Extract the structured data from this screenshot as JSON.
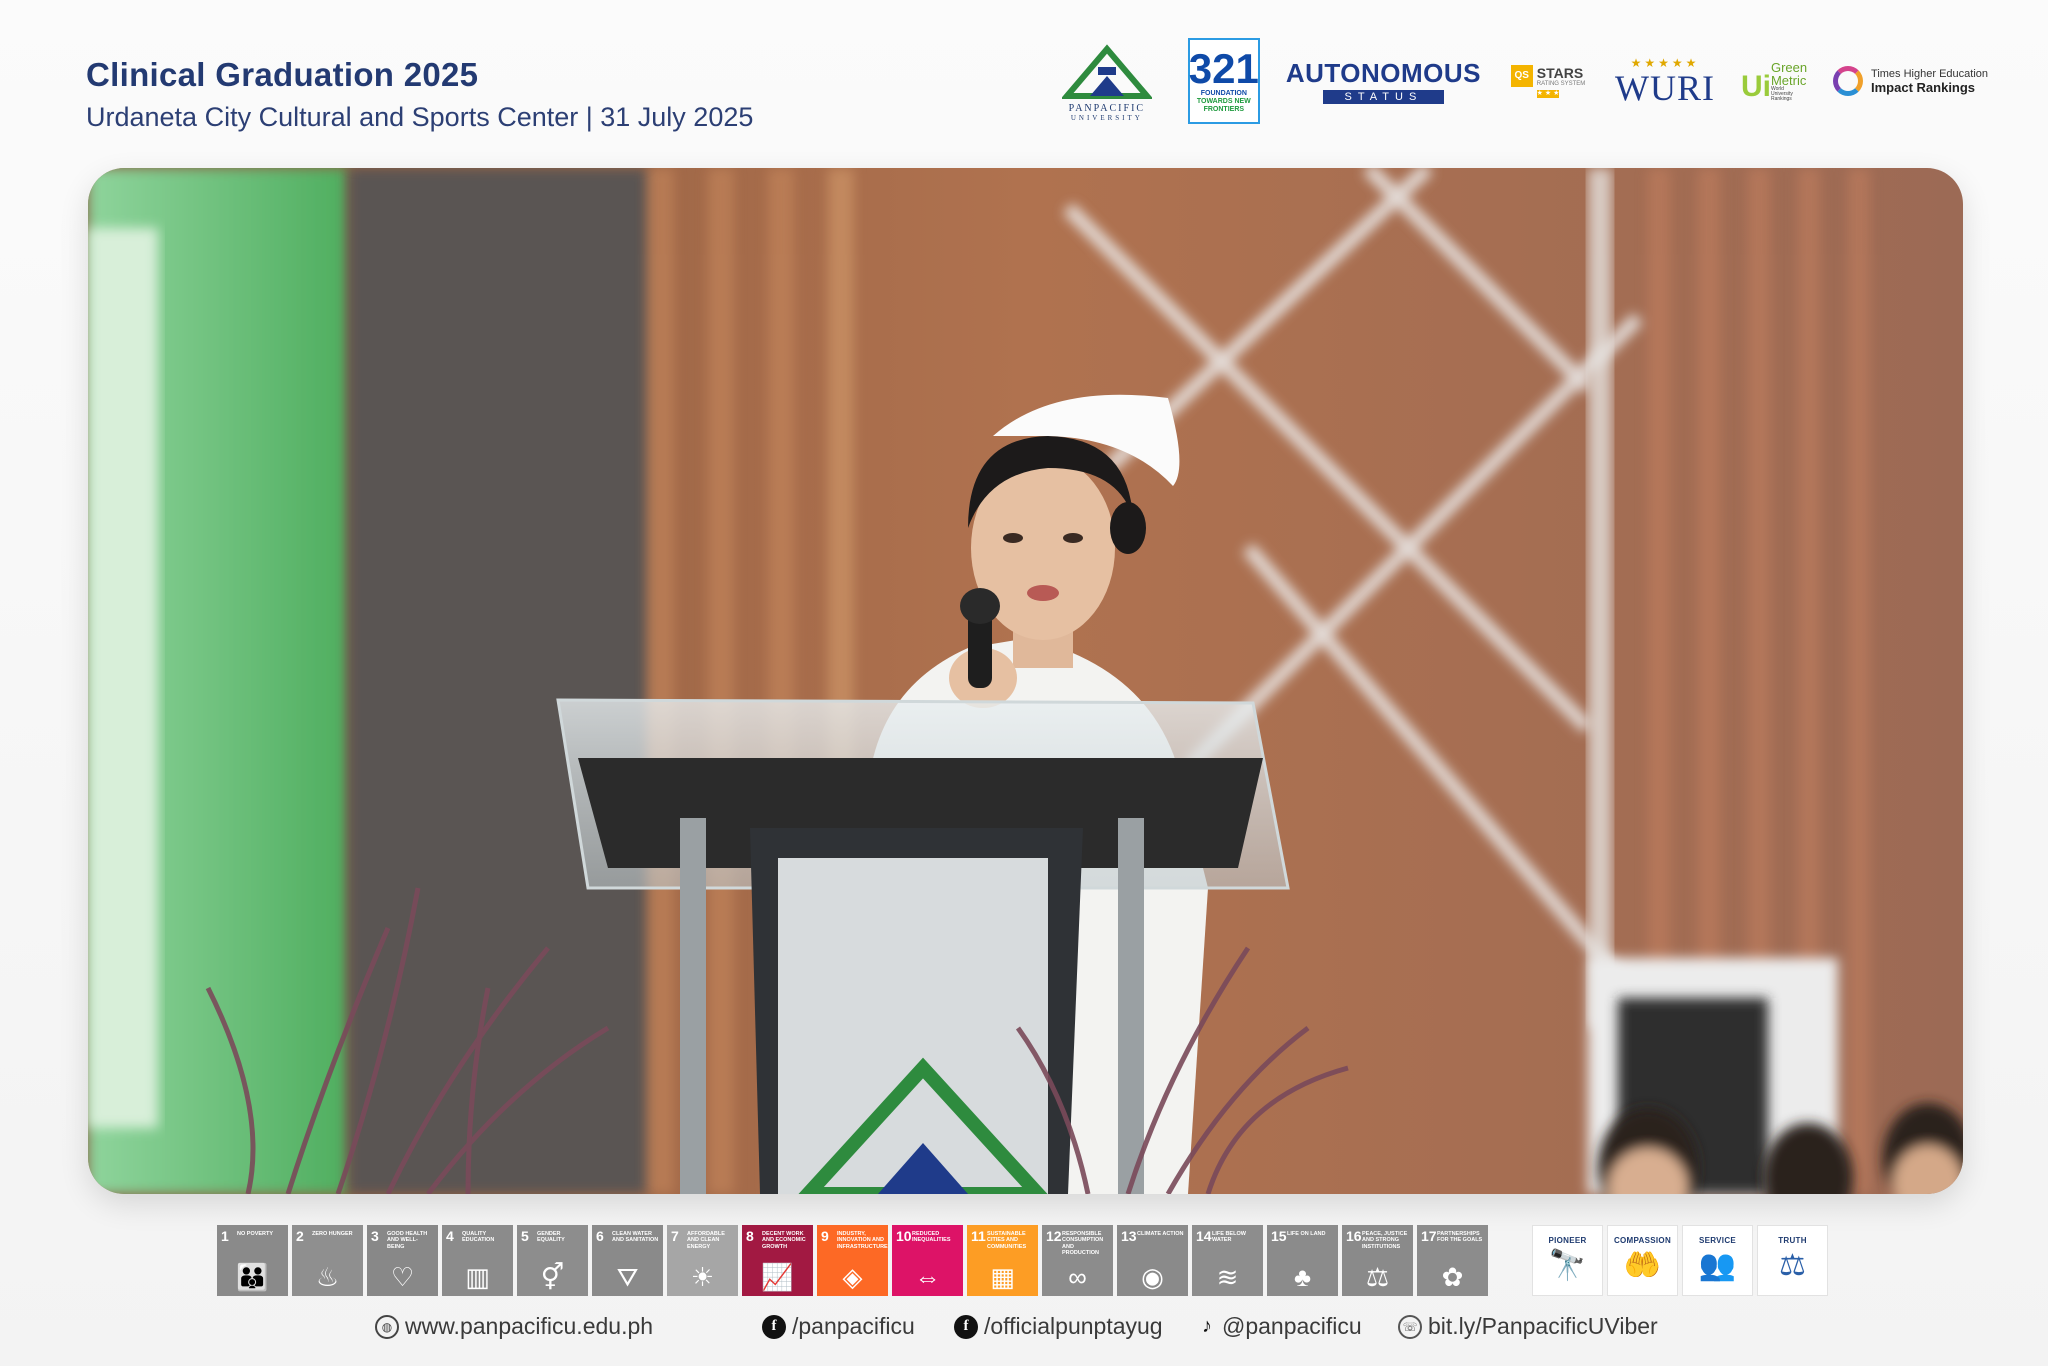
{
  "header": {
    "title": "Clinical Graduation 2025",
    "subtitle": "Urdaneta City Cultural and Sports Center | 31 July 2025"
  },
  "logos": {
    "panpacific": {
      "line1": "PANPACIFIC",
      "line2": "UNIVERSITY"
    },
    "anniversary": {
      "number": "321",
      "line1": "FOUNDATION",
      "line2": "TOWARDS NEW",
      "line3": "FRONTIERS"
    },
    "autonomous": {
      "line1": "AUTONOMOUS",
      "line2": "STATUS"
    },
    "qs": {
      "badge": "QS",
      "title": "STARS",
      "sub": "RATING SYSTEM",
      "stars": "★ ★ ★"
    },
    "wuri": {
      "stars": "★★★★★",
      "label": "WURI"
    },
    "greenmetric": {
      "ui": "Ui",
      "green": "Green",
      "metric": "Metric",
      "tiny": "World University Rankings"
    },
    "the": {
      "line1": "Times Higher Education",
      "line2": "Impact Rankings"
    }
  },
  "sdgs": [
    {
      "n": "1",
      "label": "No Poverty",
      "color": "#8a8a8a",
      "icon": "👪"
    },
    {
      "n": "2",
      "label": "Zero Hunger",
      "color": "#8f8f8f",
      "icon": "♨"
    },
    {
      "n": "3",
      "label": "Good Health and Well-Being",
      "color": "#888888",
      "icon": "♡"
    },
    {
      "n": "4",
      "label": "Quality Education",
      "color": "#8b8b8b",
      "icon": "▥"
    },
    {
      "n": "5",
      "label": "Gender Equality",
      "color": "#8d8d8d",
      "icon": "⚥"
    },
    {
      "n": "6",
      "label": "Clean Water and Sanitation",
      "color": "#8a8a8a",
      "icon": "⛛"
    },
    {
      "n": "7",
      "label": "Affordable and Clean Energy",
      "color": "#a6a6a6",
      "icon": "☀"
    },
    {
      "n": "8",
      "label": "Decent Work and Economic Growth",
      "color": "#a21942",
      "icon": "📈"
    },
    {
      "n": "9",
      "label": "Industry, Innovation and Infrastructure",
      "color": "#fd6925",
      "icon": "◈"
    },
    {
      "n": "10",
      "label": "Reduced Inequalities",
      "color": "#dd1367",
      "icon": "⇔"
    },
    {
      "n": "11",
      "label": "Sustainable Cities and Communities",
      "color": "#fd9d24",
      "icon": "▦"
    },
    {
      "n": "12",
      "label": "Responsible Consumption and Production",
      "color": "#8c8c8c",
      "icon": "∞"
    },
    {
      "n": "13",
      "label": "Climate Action",
      "color": "#8a8a8a",
      "icon": "◉"
    },
    {
      "n": "14",
      "label": "Life Below Water",
      "color": "#8d8d8d",
      "icon": "≋"
    },
    {
      "n": "15",
      "label": "Life on Land",
      "color": "#8b8b8b",
      "icon": "♣"
    },
    {
      "n": "16",
      "label": "Peace, Justice and Strong Institutions",
      "color": "#8a8a8a",
      "icon": "⚖"
    },
    {
      "n": "17",
      "label": "Partnerships for the Goals",
      "color": "#8c8c8c",
      "icon": "✿"
    }
  ],
  "core_values": [
    {
      "label": "PIONEER",
      "icon": "🔭",
      "color": "#2e8b3e"
    },
    {
      "label": "COMPASSION",
      "icon": "🤲",
      "color": "#2a5fa8"
    },
    {
      "label": "SERVICE",
      "icon": "👥",
      "color": "#2e8b3e"
    },
    {
      "label": "TRUTH",
      "icon": "⚖",
      "color": "#2a5fa8"
    }
  ],
  "footer": {
    "website": "www.panpacificu.edu.ph",
    "facebook1": "/panpacificu",
    "facebook2": "/officialpunptayug",
    "tiktok": "@panpacificu",
    "viber": "bit.ly/PanpacificUViber"
  }
}
